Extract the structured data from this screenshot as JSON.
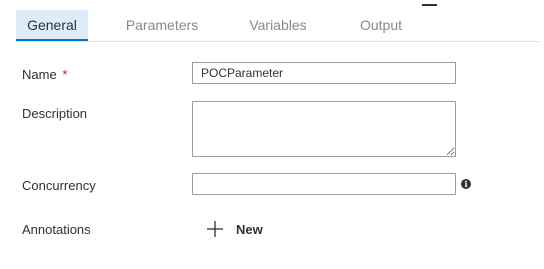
{
  "tabs": [
    {
      "label": "General",
      "active": true
    },
    {
      "label": "Parameters",
      "active": false
    },
    {
      "label": "Variables",
      "active": false
    },
    {
      "label": "Output",
      "active": false
    }
  ],
  "form": {
    "name": {
      "label": "Name",
      "required_marker": "*",
      "value": "POCParameter"
    },
    "description": {
      "label": "Description",
      "value": ""
    },
    "concurrency": {
      "label": "Concurrency",
      "value": "",
      "info_icon": "info-icon"
    },
    "annotations": {
      "label": "Annotations",
      "new_button_label": "New",
      "icon": "plus-icon"
    }
  },
  "colors": {
    "active_tab_bg": "#deecf9",
    "active_tab_underline": "#0078d4",
    "required": "#a4262c",
    "inactive_tab_text": "#8a8886"
  }
}
